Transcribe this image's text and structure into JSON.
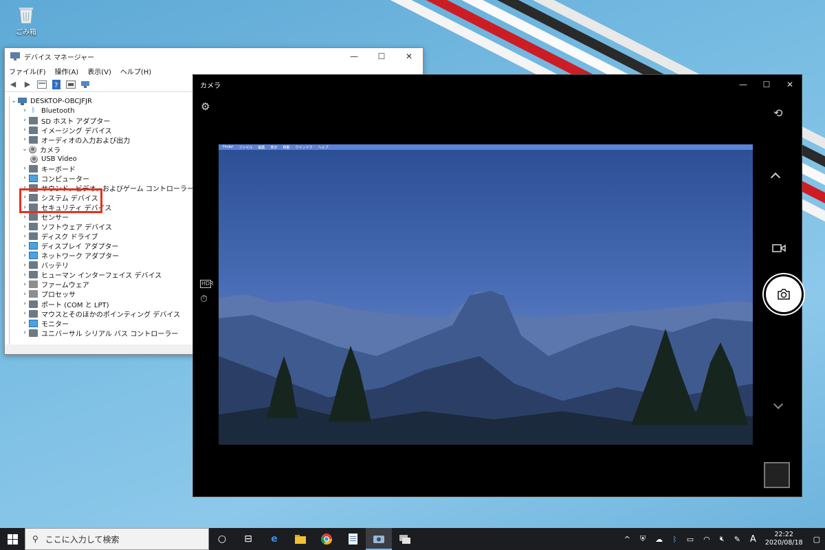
{
  "desktop": {
    "recycle_bin_label": "ごみ箱"
  },
  "device_manager": {
    "title": "デバイス マネージャー",
    "window_controls": {
      "minimize": "—",
      "maximize": "☐",
      "close": "✕"
    },
    "menu": [
      "ファイル(F)",
      "操作(A)",
      "表示(V)",
      "ヘルプ(H)"
    ],
    "root": "DESKTOP-OBCJFJR",
    "tree": [
      {
        "label": "Bluetooth",
        "expanded": false,
        "icon": "bluetooth-icon"
      },
      {
        "label": "SD ホスト アダプター",
        "expanded": false,
        "icon": "sd-host-icon"
      },
      {
        "label": "イメージング デバイス",
        "expanded": false,
        "icon": "imaging-icon"
      },
      {
        "label": "オーディオの入力および出力",
        "expanded": false,
        "icon": "audio-icon"
      },
      {
        "label": "カメラ",
        "expanded": true,
        "icon": "camera-icon"
      },
      {
        "label": "USB Video",
        "child": true,
        "icon": "webcam-icon"
      },
      {
        "label": "キーボード",
        "expanded": false,
        "icon": "keyboard-icon"
      },
      {
        "label": "コンピューター",
        "expanded": false,
        "icon": "computer-icon"
      },
      {
        "label": "サウンド、ビデオ、およびゲーム コントローラー",
        "expanded": false,
        "icon": "sound-icon"
      },
      {
        "label": "システム デバイス",
        "expanded": false,
        "icon": "system-icon"
      },
      {
        "label": "セキュリティ デバイス",
        "expanded": false,
        "icon": "security-icon"
      },
      {
        "label": "センサー",
        "expanded": false,
        "icon": "sensor-icon"
      },
      {
        "label": "ソフトウェア デバイス",
        "expanded": false,
        "icon": "software-icon"
      },
      {
        "label": "ディスク ドライブ",
        "expanded": false,
        "icon": "disk-icon"
      },
      {
        "label": "ディスプレイ アダプター",
        "expanded": false,
        "icon": "display-adapter-icon"
      },
      {
        "label": "ネットワーク アダプター",
        "expanded": false,
        "icon": "network-icon"
      },
      {
        "label": "バッテリ",
        "expanded": false,
        "icon": "battery-icon"
      },
      {
        "label": "ヒューマン インターフェイス デバイス",
        "expanded": false,
        "icon": "hid-icon"
      },
      {
        "label": "ファームウェア",
        "expanded": false,
        "icon": "firmware-icon"
      },
      {
        "label": "プロセッサ",
        "expanded": false,
        "icon": "processor-icon"
      },
      {
        "label": "ポート (COM と LPT)",
        "expanded": false,
        "icon": "port-icon"
      },
      {
        "label": "マウスとそのほかのポインティング デバイス",
        "expanded": false,
        "icon": "mouse-icon"
      },
      {
        "label": "モニター",
        "expanded": false,
        "icon": "monitor-icon"
      },
      {
        "label": "ユニバーサル シリアル バス コントローラー",
        "expanded": false,
        "icon": "usb-icon"
      }
    ]
  },
  "camera_app": {
    "title": "カメラ",
    "window_controls": {
      "minimize": "—",
      "maximize": "☐",
      "close": "✕"
    },
    "hdr_label": "HDR",
    "viewfinder_menubar": [
      "Finder",
      "ファイル",
      "編集",
      "表示",
      "移動",
      "ウインドウ",
      "ヘルプ"
    ]
  },
  "taskbar": {
    "search_placeholder": "ここに入力して検索",
    "input_indicator": "A",
    "time": "22:22",
    "date": "2020/08/18"
  },
  "colors": {
    "highlight_box": "#e8301c",
    "taskbar_bg": "#1b1d20",
    "desktop_bg": "#79bde3"
  }
}
